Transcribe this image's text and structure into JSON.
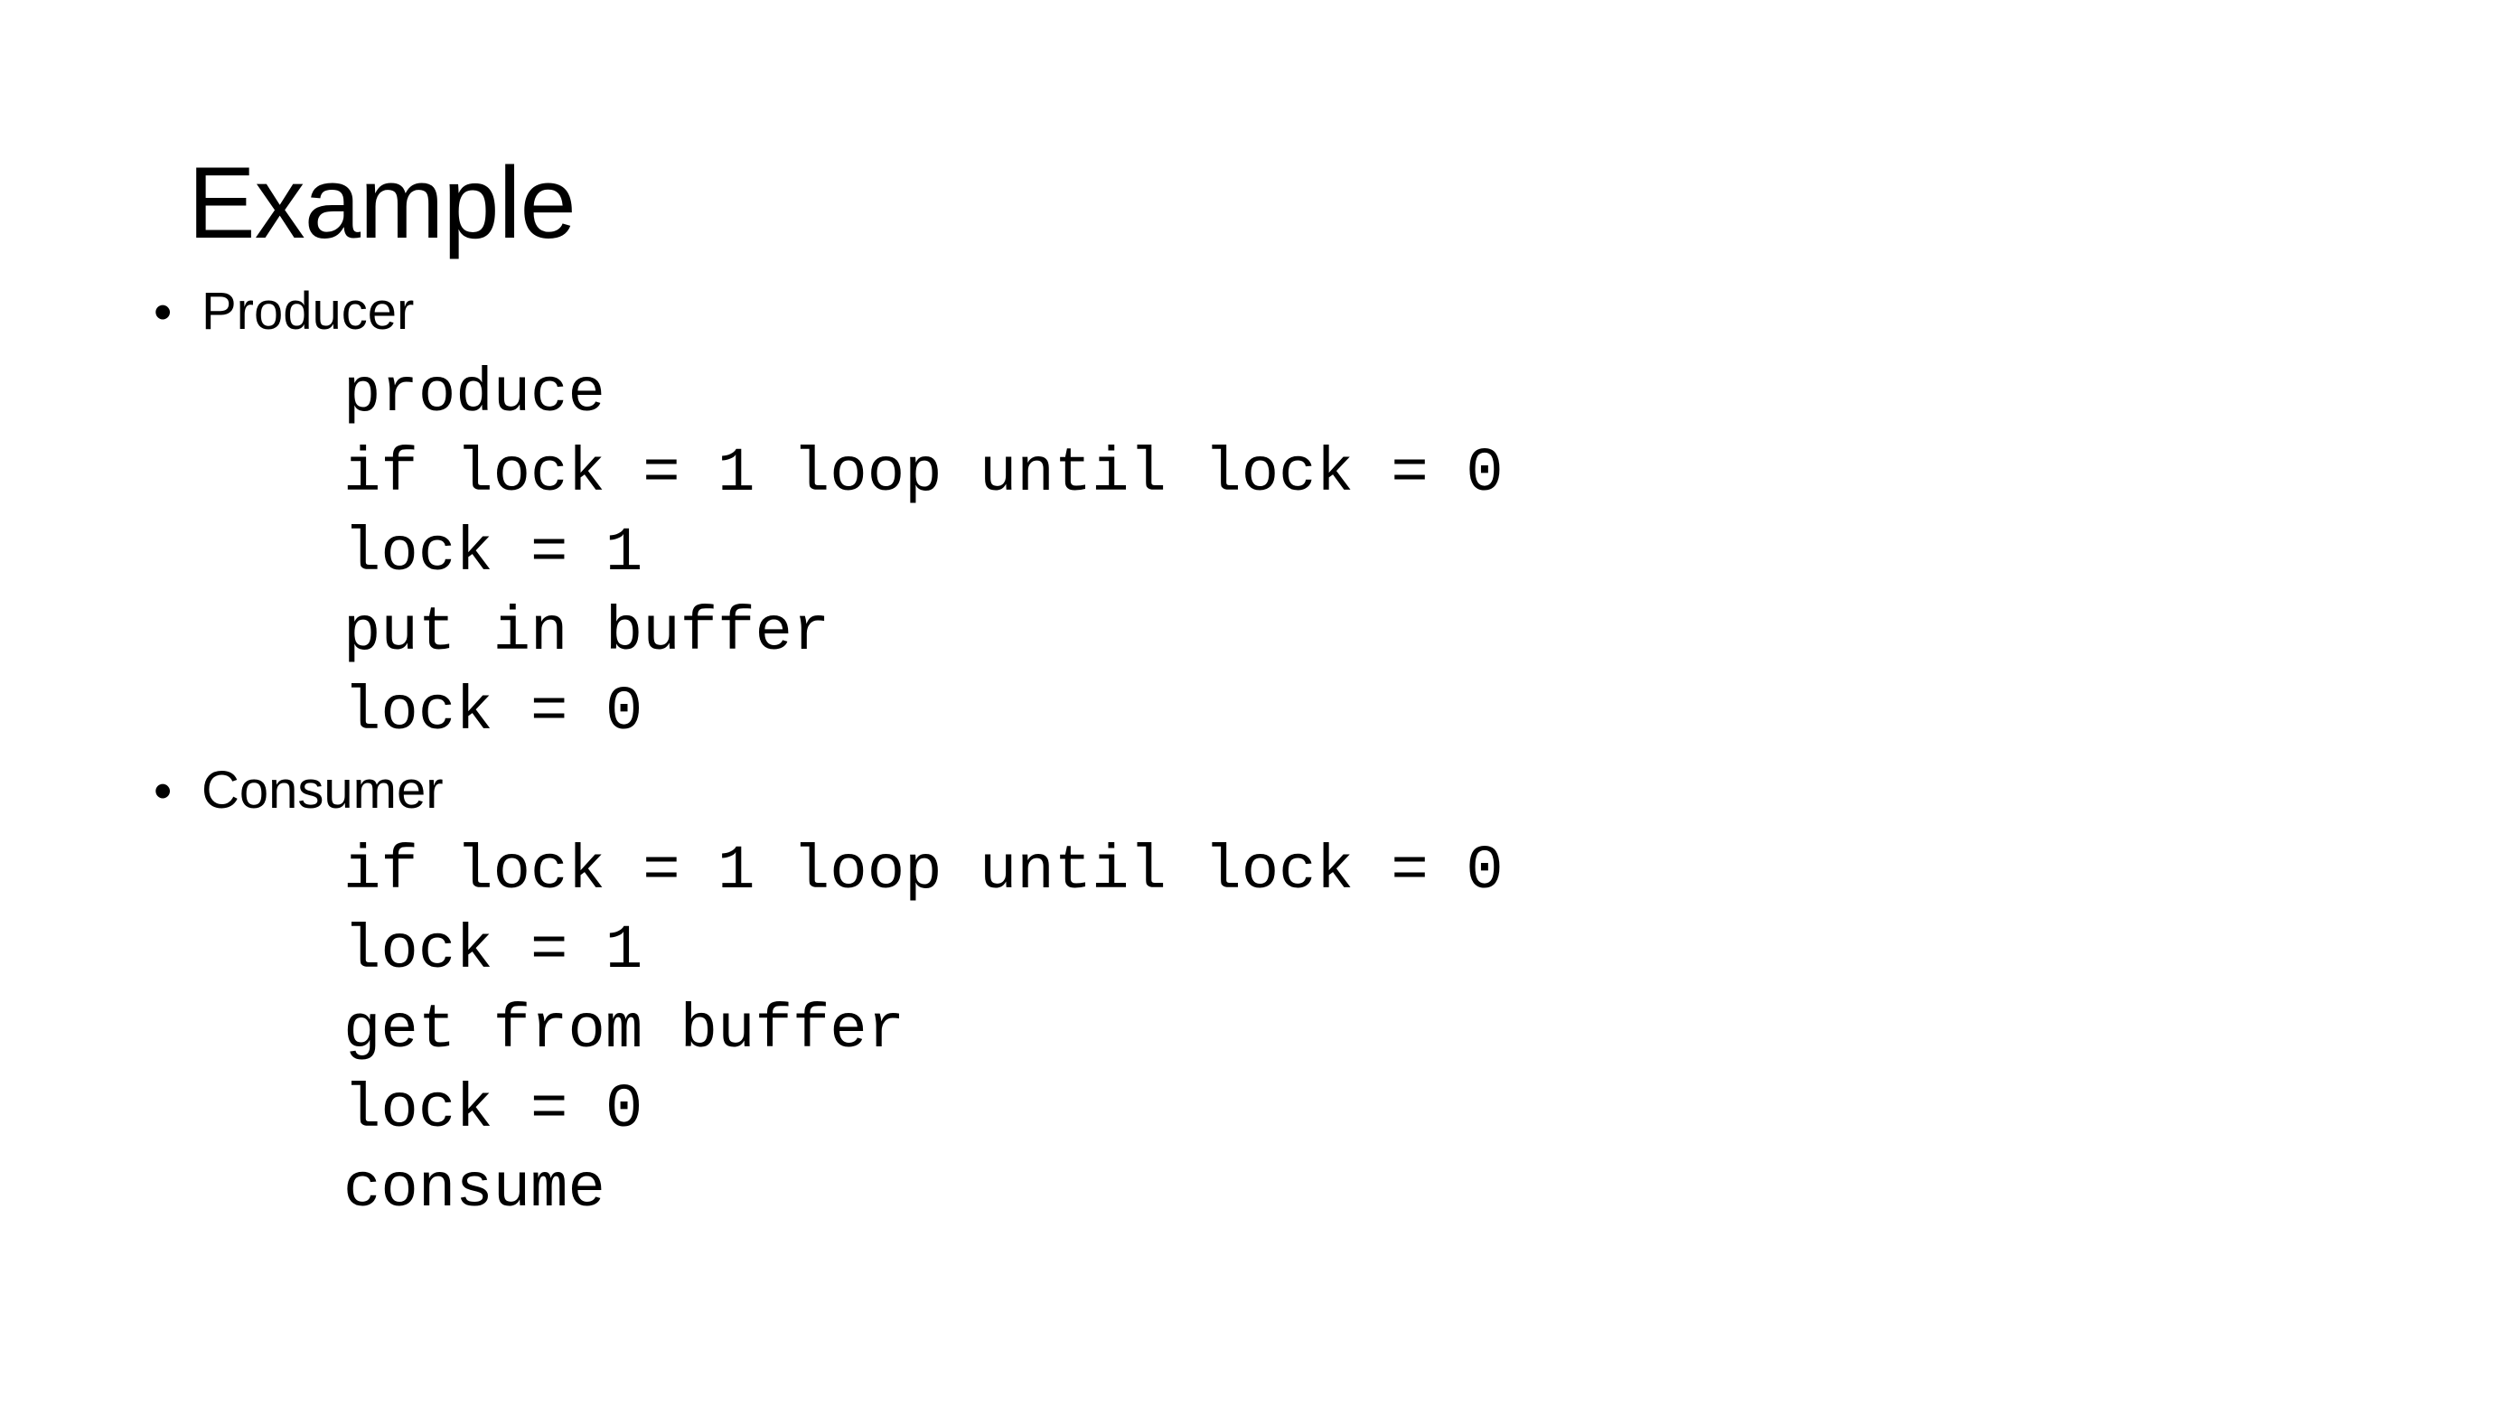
{
  "slide": {
    "title": "Example",
    "sections": [
      {
        "bullet": "•",
        "label": "Producer",
        "code_lines": [
          "produce",
          "if lock = 1 loop until lock = 0",
          "lock = 1",
          "put in buffer",
          "lock = 0"
        ]
      },
      {
        "bullet": "•",
        "label": "Consumer",
        "code_lines": [
          "if lock = 1 loop until lock = 0",
          "lock = 1",
          "get from buffer",
          "lock = 0",
          "consume"
        ]
      }
    ]
  },
  "colors": {
    "background": "#ffffff",
    "text": "#000000"
  }
}
